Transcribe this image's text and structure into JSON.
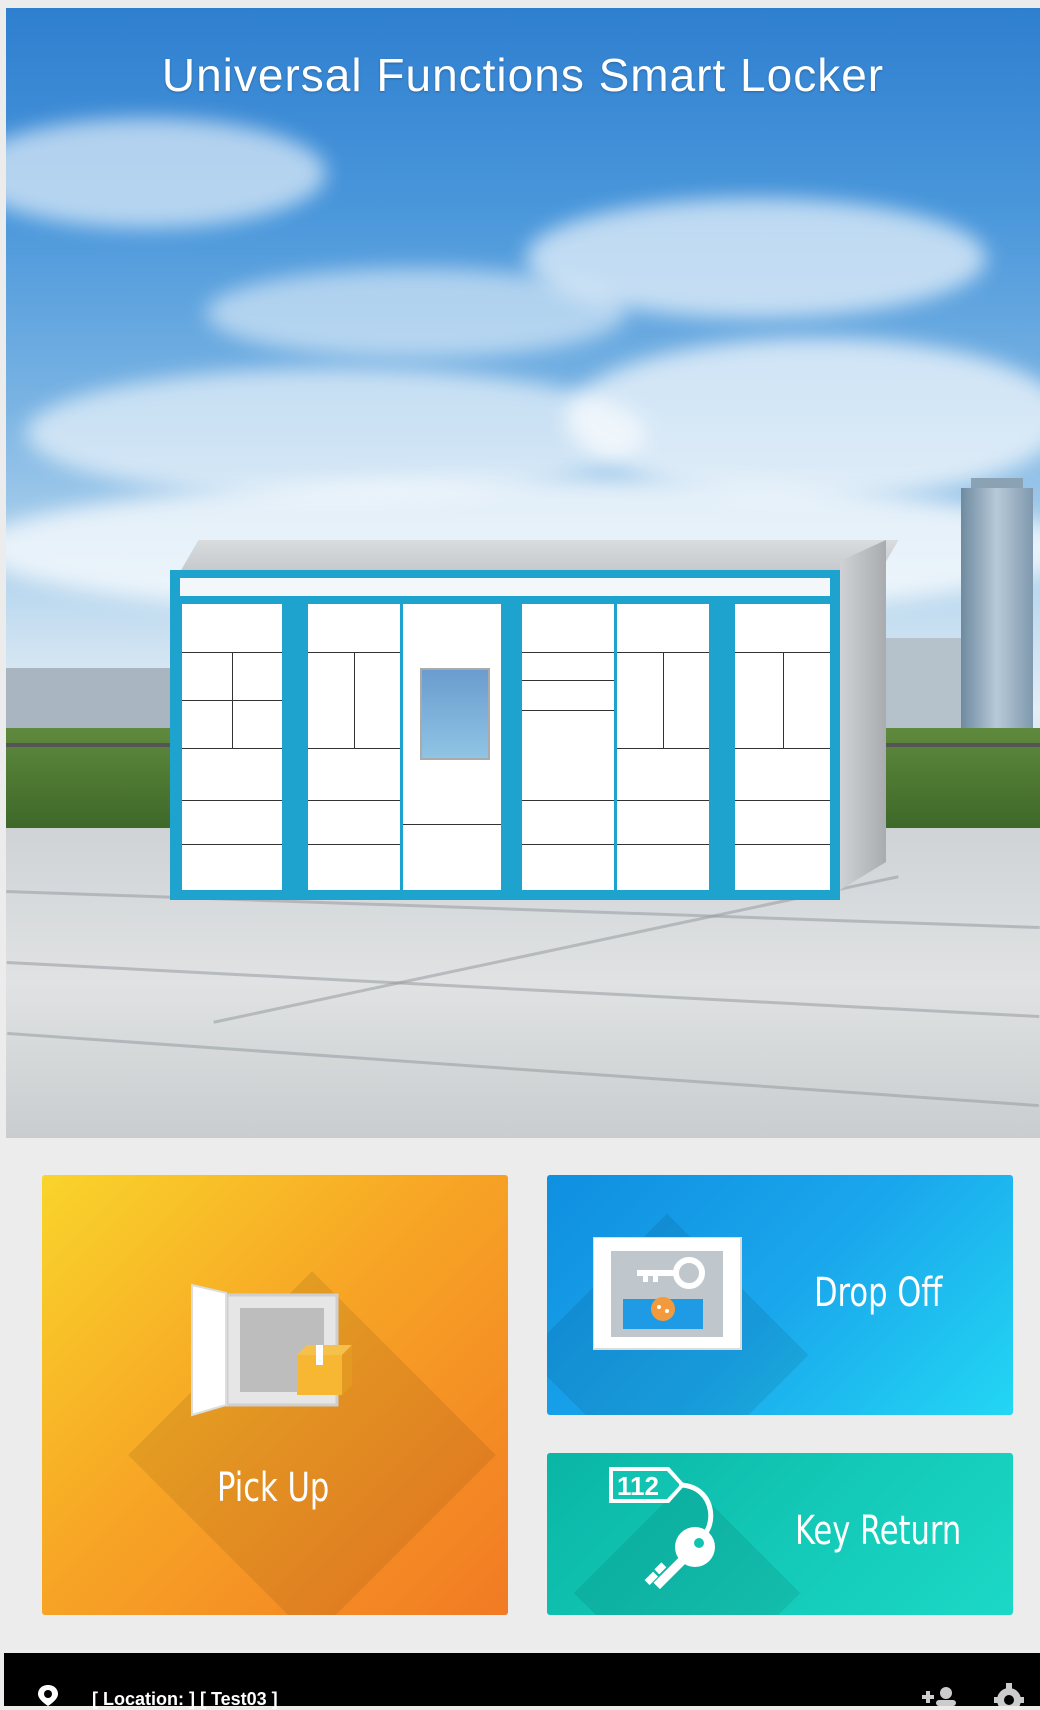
{
  "hero": {
    "title": "Universal Functions Smart Locker"
  },
  "tiles": {
    "pickup": {
      "label": "Pick Up",
      "color_from": "#f9d42b",
      "color_to": "#f27a24"
    },
    "dropoff": {
      "label": "Drop Off",
      "color_from": "#0f8fe0",
      "color_to": "#23d7f3"
    },
    "keyreturn": {
      "label": "Key Return",
      "color_from": "#0ab6a6",
      "color_to": "#1bd9c6",
      "tag_text": "112"
    }
  },
  "status_bar": {
    "location_text": "[ Location: ]    [ Test03 ]",
    "icons": [
      "location-pin-icon",
      "add-user-icon",
      "gear-icon"
    ]
  }
}
